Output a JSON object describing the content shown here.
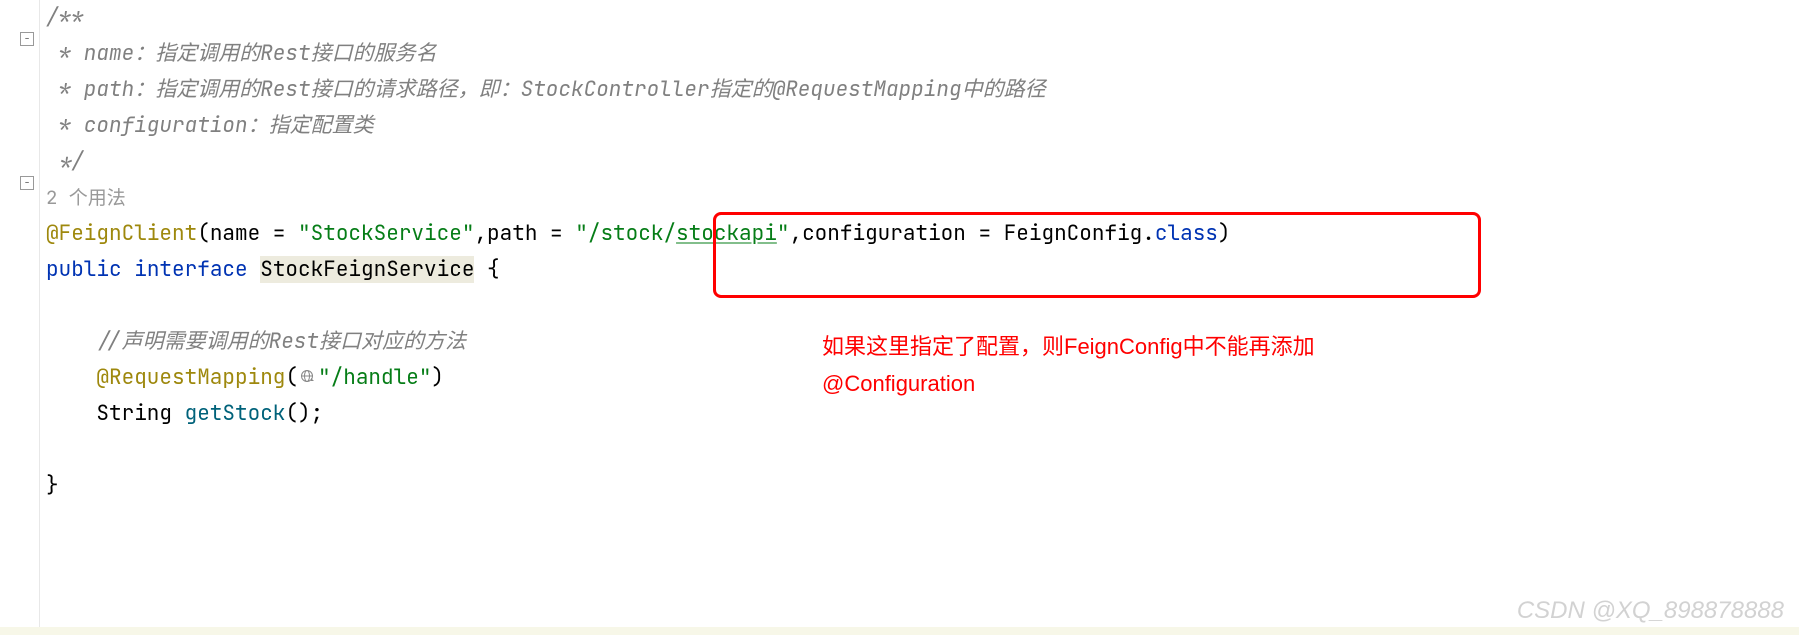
{
  "gutter": {
    "fold_top": "−",
    "fold_bottom": "−"
  },
  "code": {
    "comment_open": "/**",
    "comment_line1_prefix": " * name：",
    "comment_line1_text": "指定调用的Rest接口的服务名",
    "comment_line2_prefix": " * path：",
    "comment_line2_text": "指定调用的Rest接口的请求路径，即：StockController指定的@RequestMapping中的路径",
    "comment_line3_prefix": " * configuration：",
    "comment_line3_text": "指定配置类",
    "comment_close": " */",
    "usages": "2 个用法",
    "annotation_feign": "@FeignClient",
    "feign_paren_open": "(",
    "feign_name_attr": "name = ",
    "feign_name_value": "\"StockService\"",
    "feign_comma1": ",",
    "feign_path_attr": "path = ",
    "feign_path_quote_open": "\"",
    "feign_path_value1": "/stock/",
    "feign_path_value2": "stockapi",
    "feign_path_quote_close": "\"",
    "feign_comma2": ",",
    "feign_config_attr": "configuration = ",
    "feign_config_value": "FeignConfig",
    "feign_dot": ".",
    "feign_class": "class",
    "feign_paren_close": ")",
    "kw_public": "public",
    "kw_interface": "interface",
    "class_name": "StockFeignService",
    "brace_open": " {",
    "inner_comment": "//声明需要调用的Rest接口对应的方法",
    "annotation_mapping": "@RequestMapping",
    "mapping_paren_open": "(",
    "mapping_value": "\"/handle\"",
    "mapping_paren_close": ")",
    "return_type": "String ",
    "method_name": "getStock",
    "method_suffix": "();",
    "brace_close": "}"
  },
  "annotation": {
    "note_line1": "如果这里指定了配置，则FeignConfig中不能再添加",
    "note_line2": "@Configuration"
  },
  "watermark": "CSDN @XQ_898878888"
}
